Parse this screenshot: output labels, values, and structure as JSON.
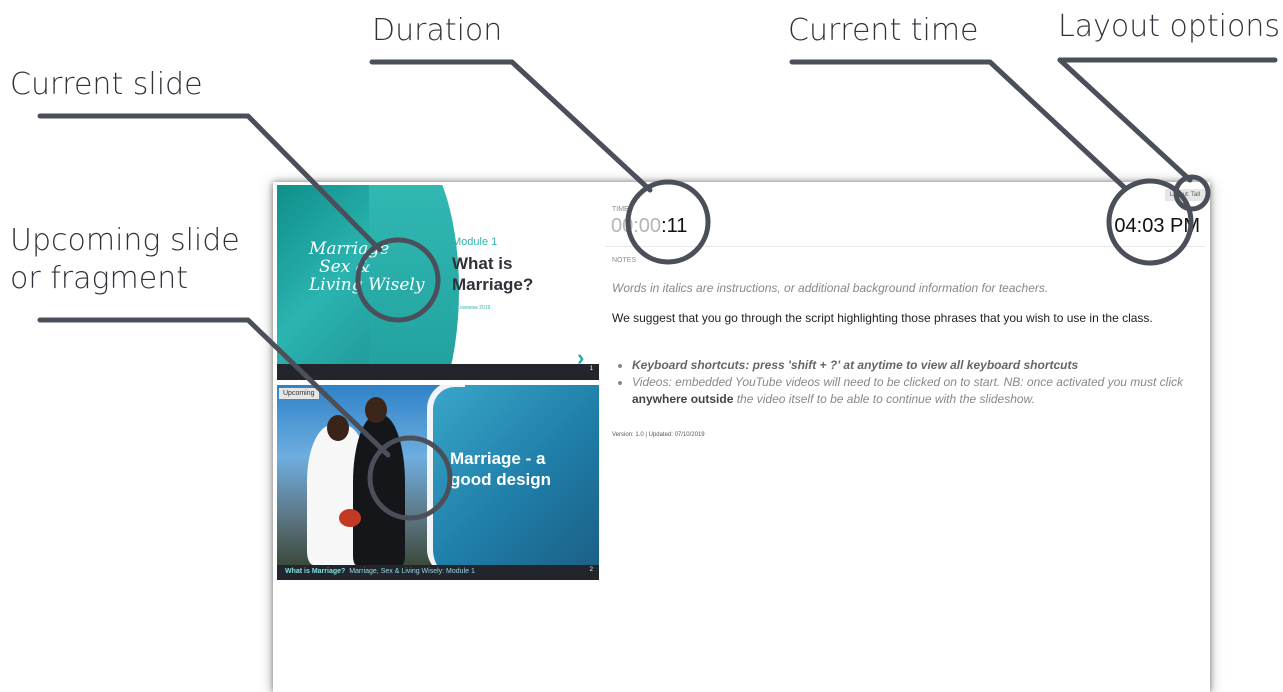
{
  "callouts": {
    "duration": "Duration",
    "current_time": "Current time",
    "layout_options": "Layout options",
    "current_slide": "Current slide",
    "upcoming_line1": "Upcoming slide",
    "upcoming_line2": "or fragment"
  },
  "current_slide": {
    "logo_lines": [
      "Marriage",
      "Sex &",
      "Living Wisely"
    ],
    "module": "Module 1",
    "title": "What is Marriage?",
    "copyright": "© Lovewise 2019",
    "arrow": "›",
    "number": "1"
  },
  "upcoming_slide": {
    "badge": "Upcoming",
    "title": "Marriage - a good design",
    "caption_bold": "What is Marriage?",
    "caption_rest": "Marriage, Sex & Living Wisely: Module 1",
    "number": "2"
  },
  "timer": {
    "label": "TIME",
    "dim_part": "00:00",
    "bright_part": ":11"
  },
  "clock": {
    "value": "04:03 PM"
  },
  "layout_button": {
    "label": "Layout: Tall"
  },
  "notes": {
    "label": "NOTES",
    "italic_intro": "Words in italics are instructions, or additional background information for teachers.",
    "body": "We suggest that you go through the script highlighting those phrases that you wish to use in the class.",
    "bullet1": "Keyboard shortcuts: press 'shift + ?' at anytime to view all keyboard shortcuts",
    "bullet2_start": "Videos: embedded YouTube videos will need to be clicked on to start. NB: once activated you must click ",
    "bullet2_bold": "anywhere outside",
    "bullet2_end": " the video itself to be able to continue with the slideshow."
  },
  "version": "Version: 1.0 | Updated: 07/10/2019",
  "colors": {
    "teal": "#2bb4b0",
    "annotation": "#4a4f59"
  }
}
